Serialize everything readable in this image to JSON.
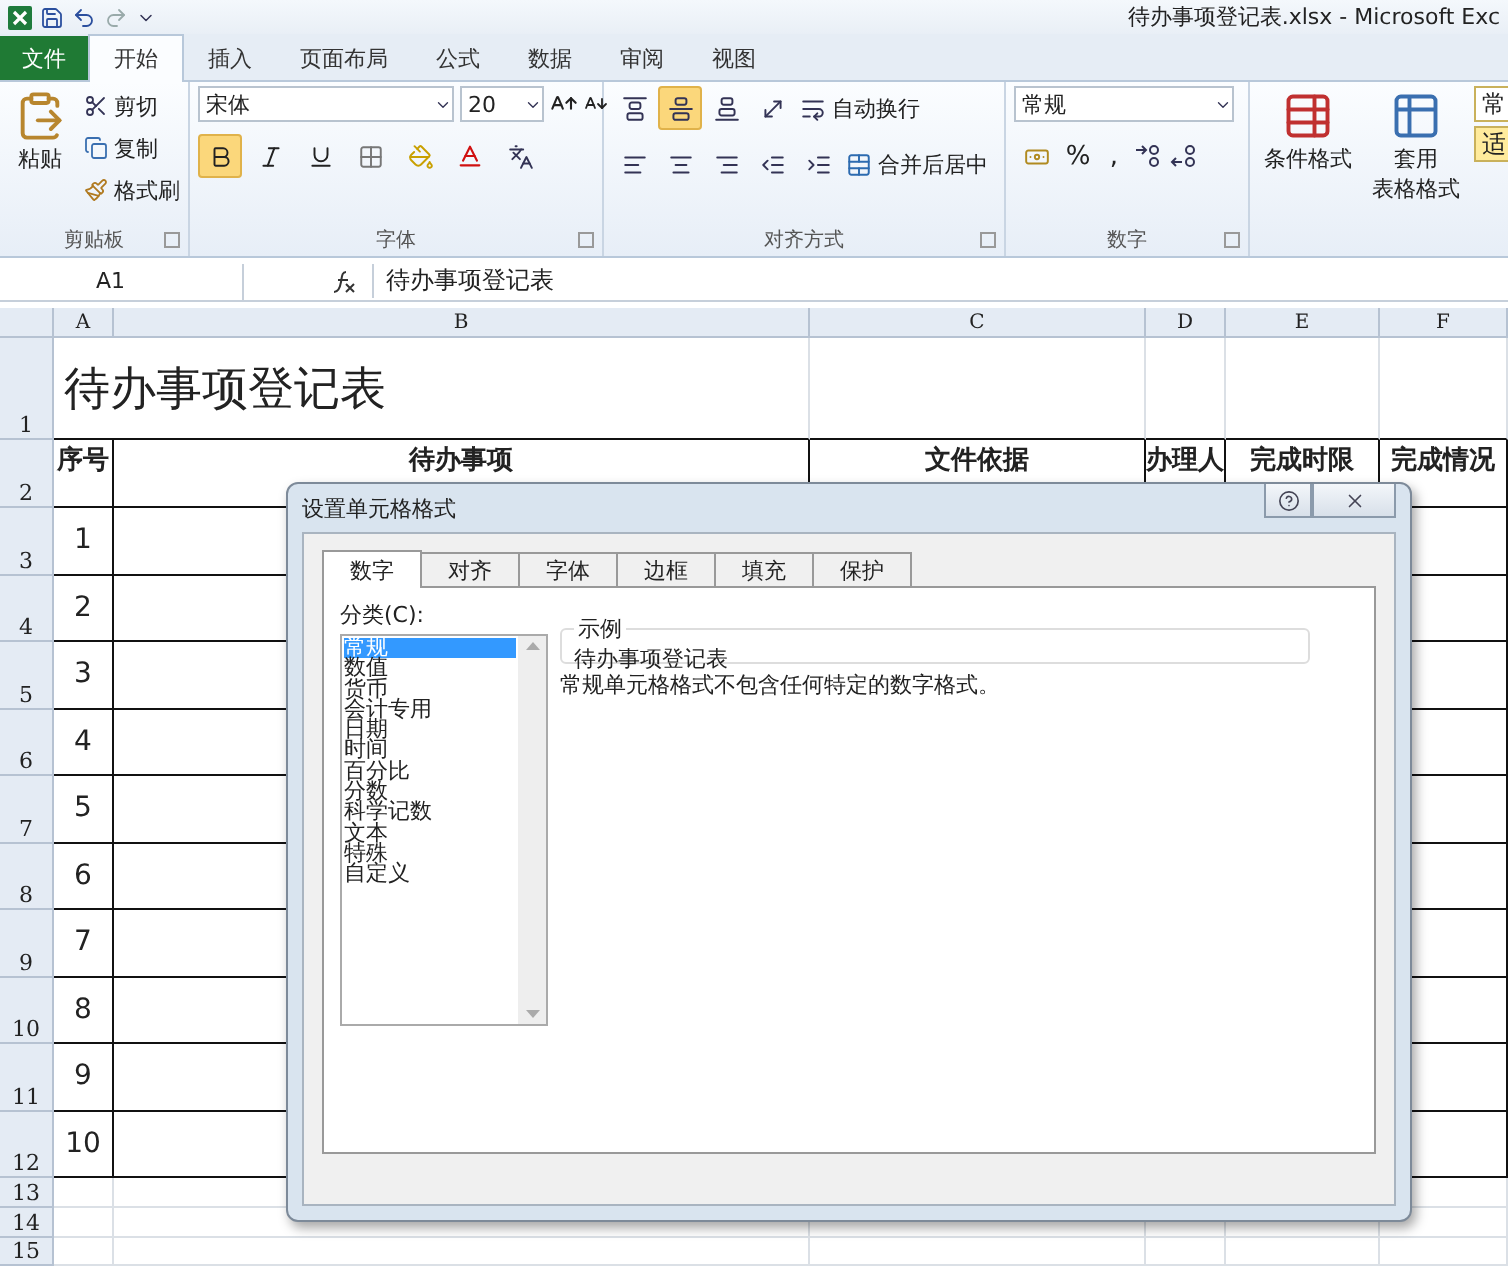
{
  "window": {
    "title": "待办事项登记表.xlsx - Microsoft Exc"
  },
  "ribbon_tabs": [
    {
      "label": "文件",
      "kind": "file",
      "selected": false
    },
    {
      "label": "开始",
      "kind": "tab",
      "selected": true
    },
    {
      "label": "插入",
      "kind": "tab",
      "selected": false
    },
    {
      "label": "页面布局",
      "kind": "tab",
      "selected": false
    },
    {
      "label": "公式",
      "kind": "tab",
      "selected": false
    },
    {
      "label": "数据",
      "kind": "tab",
      "selected": false
    },
    {
      "label": "审阅",
      "kind": "tab",
      "selected": false
    },
    {
      "label": "视图",
      "kind": "tab",
      "selected": false
    }
  ],
  "clipboard": {
    "label": "剪贴板",
    "paste": "粘贴",
    "cut": "剪切",
    "copy": "复制",
    "format_painter": "格式刷"
  },
  "font": {
    "label": "字体",
    "font_name": "宋体",
    "font_size": "20",
    "bold": true
  },
  "alignment": {
    "label": "对齐方式",
    "middle_align": true,
    "wrap_text": "自动换行",
    "merge_center": "合并后居中"
  },
  "number": {
    "label": "数字",
    "format": "常规",
    "percent": "%",
    "comma": ","
  },
  "styles": {
    "conditional_format": "条件格式",
    "table_format_line1": "套用",
    "table_format_line2": "表格格式",
    "style_normal": "常",
    "style_neutral": "适"
  },
  "formula_bar": {
    "name_box": "A1",
    "content": "待办事项登记表"
  },
  "sheet": {
    "columns": [
      "A",
      "B",
      "C",
      "D",
      "E",
      "F"
    ],
    "row_numbers": [
      "1",
      "2",
      "3",
      "4",
      "5",
      "6",
      "7",
      "8",
      "9",
      "10",
      "11",
      "12",
      "13",
      "14",
      "15"
    ],
    "title": "待办事项登记表",
    "headers": [
      "序号",
      "待办事项",
      "文件依据",
      "办理人",
      "完成时限",
      "完成情况"
    ],
    "serials": [
      "1",
      "2",
      "3",
      "4",
      "5",
      "6",
      "7",
      "8",
      "9",
      "10"
    ]
  },
  "dialog": {
    "title": "设置单元格格式",
    "tabs": [
      {
        "label": "数字",
        "selected": true
      },
      {
        "label": "对齐",
        "selected": false
      },
      {
        "label": "字体",
        "selected": false
      },
      {
        "label": "边框",
        "selected": false
      },
      {
        "label": "填充",
        "selected": false
      },
      {
        "label": "保护",
        "selected": false
      }
    ],
    "category_label": "分类(C):",
    "categories": [
      {
        "label": "常规",
        "selected": true
      },
      {
        "label": "数值",
        "selected": false
      },
      {
        "label": "货币",
        "selected": false
      },
      {
        "label": "会计专用",
        "selected": false
      },
      {
        "label": "日期",
        "selected": false
      },
      {
        "label": "时间",
        "selected": false
      },
      {
        "label": "百分比",
        "selected": false
      },
      {
        "label": "分数",
        "selected": false
      },
      {
        "label": "科学记数",
        "selected": false
      },
      {
        "label": "文本",
        "selected": false
      },
      {
        "label": "特殊",
        "selected": false
      },
      {
        "label": "自定义",
        "selected": false
      }
    ],
    "sample_label": "示例",
    "sample_value": "待办事项登记表",
    "description": "常规单元格格式不包含任何特定的数字格式。"
  }
}
